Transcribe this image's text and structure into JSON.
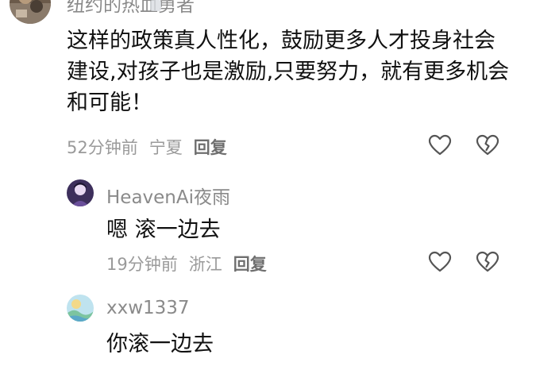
{
  "comments": [
    {
      "username": "纽约的热血勇者",
      "body": "这样的政策真人性化，鼓励更多人才投身社会建设,对孩子也是激励,只要努力，就有更多机会和可能！",
      "time": "52分钟前",
      "location": "宁夏",
      "reply_label": "回复"
    },
    {
      "username": "HeavenAi夜雨",
      "body": "嗯 滚一边去",
      "time": "19分钟前",
      "location": "浙江",
      "reply_label": "回复"
    },
    {
      "username": "xxw1337",
      "body": "你滚一边去"
    }
  ],
  "icons": {
    "like": "heart-outline-icon",
    "dislike": "broken-heart-icon"
  },
  "colors": {
    "username": "#8a8a8a",
    "meta": "#9a9a9a",
    "reply": "#6f6f6f",
    "icon_stroke": "#555555"
  }
}
